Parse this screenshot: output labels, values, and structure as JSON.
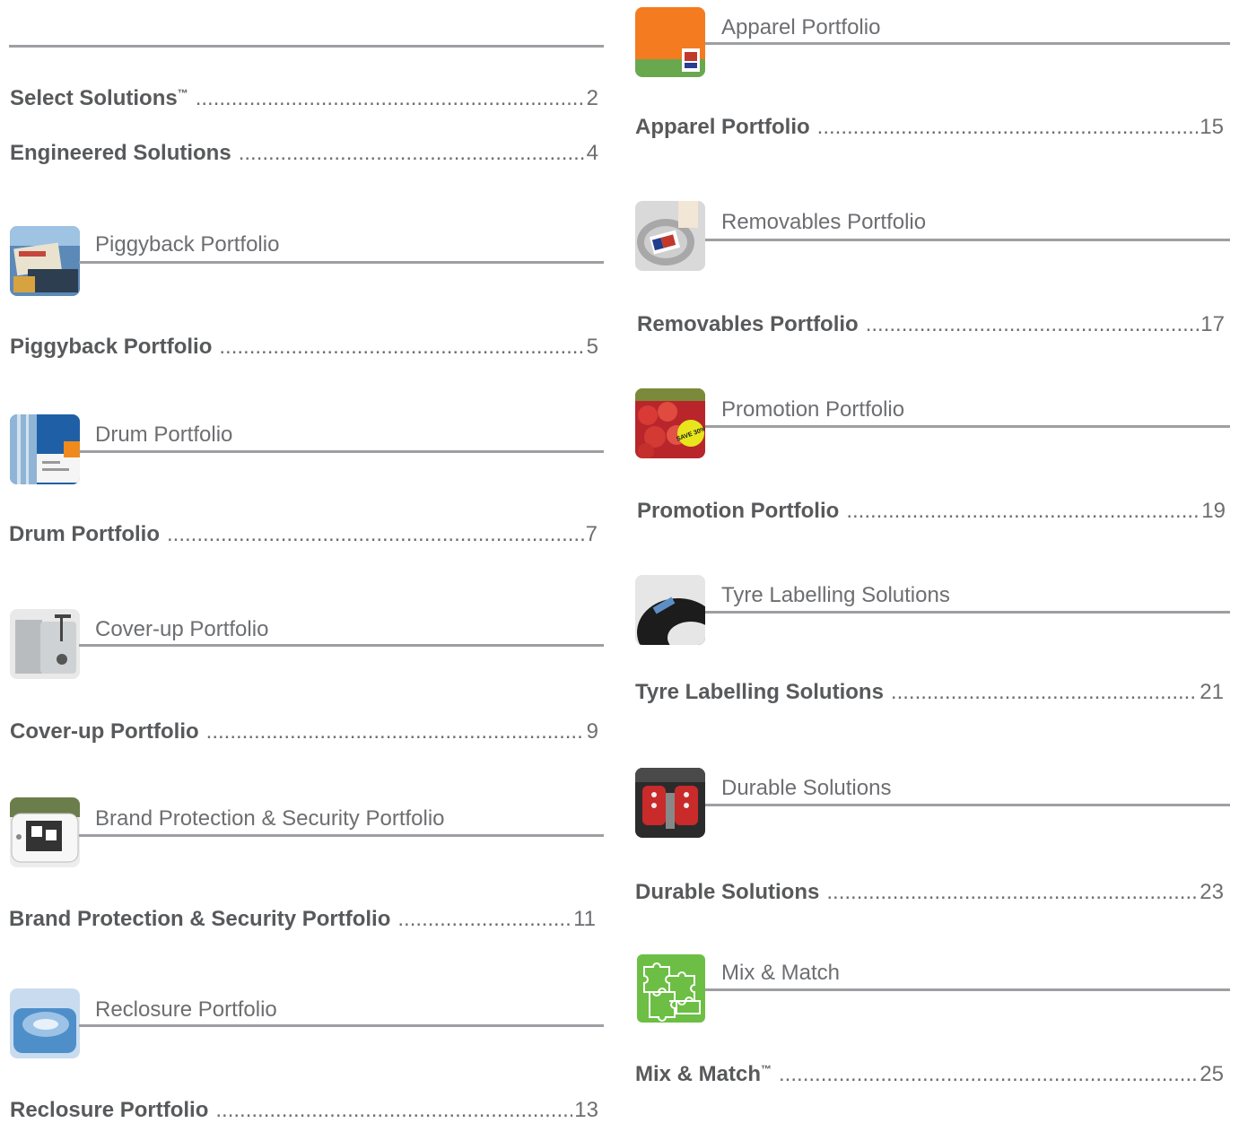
{
  "left_column": {
    "top_entries": [
      {
        "label": "Select Solutions",
        "tm": "™",
        "page": "2"
      },
      {
        "label": "Engineered Solutions",
        "tm": "",
        "page": "4"
      }
    ],
    "sections": [
      {
        "heading": "Piggyback Portfolio",
        "icon": "piggyback-photo-icon",
        "entry": {
          "label": "Piggyback Portfolio",
          "page": "5"
        }
      },
      {
        "heading": "Drum Portfolio",
        "icon": "drum-photo-icon",
        "entry": {
          "label": "Drum Portfolio",
          "page": "7"
        }
      },
      {
        "heading": "Cover-up  Portfolio",
        "icon": "toaster-photo-icon",
        "entry": {
          "label": "Cover-up Portfolio",
          "page": "9"
        }
      },
      {
        "heading": "Brand Protection & Security Portfolio",
        "icon": "security-device-photo-icon",
        "entry": {
          "label": "Brand Protection & Security Portfolio",
          "page": "11"
        }
      },
      {
        "heading": "Reclosure Portfolio",
        "icon": "wipes-pack-photo-icon",
        "entry": {
          "label": "Reclosure Portfolio",
          "page": "13"
        }
      }
    ]
  },
  "right_column": {
    "sections": [
      {
        "heading": "Apparel Portfolio",
        "icon": "apparel-tag-photo-icon",
        "entry": {
          "label": "Apparel Portfolio",
          "tm": "",
          "page": "15"
        }
      },
      {
        "heading": "Removables Portfolio",
        "icon": "cookware-photo-icon",
        "entry": {
          "label": "Removables Portfolio",
          "tm": "",
          "page": "17"
        }
      },
      {
        "heading": "Promotion Portfolio",
        "icon": "tomato-save-photo-icon",
        "badge_text": "SAVE 30%",
        "entry": {
          "label": "Promotion Portfolio",
          "tm": "",
          "page": "19"
        }
      },
      {
        "heading": "Tyre Labelling Solutions",
        "icon": "tyre-photo-icon",
        "entry": {
          "label": "Tyre Labelling Solutions",
          "tm": "",
          "page": "21"
        }
      },
      {
        "heading": "Durable Solutions",
        "icon": "engine-photo-icon",
        "entry": {
          "label": "Durable Solutions",
          "tm": "",
          "page": "23"
        }
      },
      {
        "heading": "Mix & Match",
        "icon": "puzzle-icon",
        "entry": {
          "label": "Mix & Match",
          "tm": "™",
          "page": "25"
        }
      }
    ]
  },
  "colors": {
    "text": "#58595b",
    "rule": "#9d9fa2",
    "puzzle_green": "#6cbf44"
  }
}
